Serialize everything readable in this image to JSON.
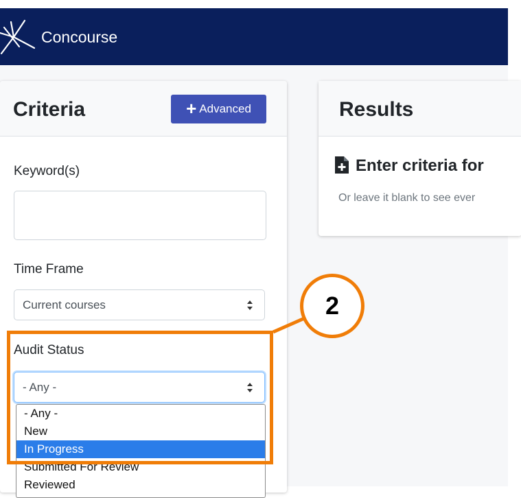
{
  "app": {
    "title": "Concourse"
  },
  "criteria": {
    "title": "Criteria",
    "advanced_label": "Advanced",
    "keyword_label": "Keyword(s)",
    "keyword_value": "",
    "timeframe_label": "Time Frame",
    "timeframe_value": "Current courses",
    "audit_label": "Audit Status",
    "audit_value": "- Any -",
    "audit_options": [
      "- Any -",
      "New",
      "In Progress",
      "Submitted For Review",
      "Reviewed"
    ],
    "audit_highlighted": "In Progress"
  },
  "results": {
    "title": "Results",
    "empty_heading": "Enter criteria for",
    "empty_sub": "Or leave it blank to see ever"
  },
  "annotation": {
    "number": "2",
    "color": "#f07d08"
  },
  "colors": {
    "navbar": "#0a1f5c",
    "accent": "#3f51b5",
    "option_highlight": "#2b7de9"
  }
}
